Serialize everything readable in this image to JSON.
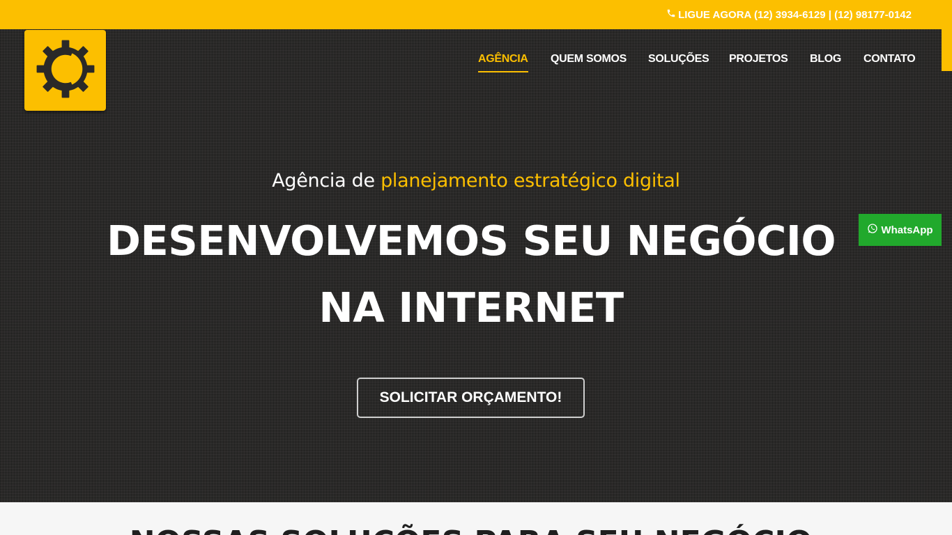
{
  "topbar": {
    "phone_text": "LIGUE AGORA (12) 3934-6129 | (12) 98177-0142",
    "icon": "phone-icon",
    "color": "#fcbf00"
  },
  "logo": {
    "icon": "gear-logo-icon"
  },
  "nav": {
    "items": [
      {
        "label": "AGÊNCIA",
        "active": true
      },
      {
        "label": "QUEM SOMOS"
      },
      {
        "label": "SOLUÇÕES"
      },
      {
        "label": "PROJETOS"
      },
      {
        "label": "BLOG"
      },
      {
        "label": "CONTATO"
      }
    ]
  },
  "hero": {
    "subtitle_prefix": "Agência de ",
    "subtitle_highlight": "planejamento estratégico digital",
    "headline_line1": "DESENVOLVEMOS SEU NEGÓCIO",
    "headline_line2": "NA INTERNET",
    "cta_label": "SOLICITAR ORÇAMENTO!"
  },
  "whatsapp": {
    "label": "WhatsApp",
    "icon": "whatsapp-icon",
    "color": "#21a92c"
  },
  "section2": {
    "title": "NOSSAS SOLUÇÕES PARA SEU NEGÓCIO"
  },
  "colors": {
    "accent": "#fcbf00",
    "hero_bg": "#2a2928"
  }
}
